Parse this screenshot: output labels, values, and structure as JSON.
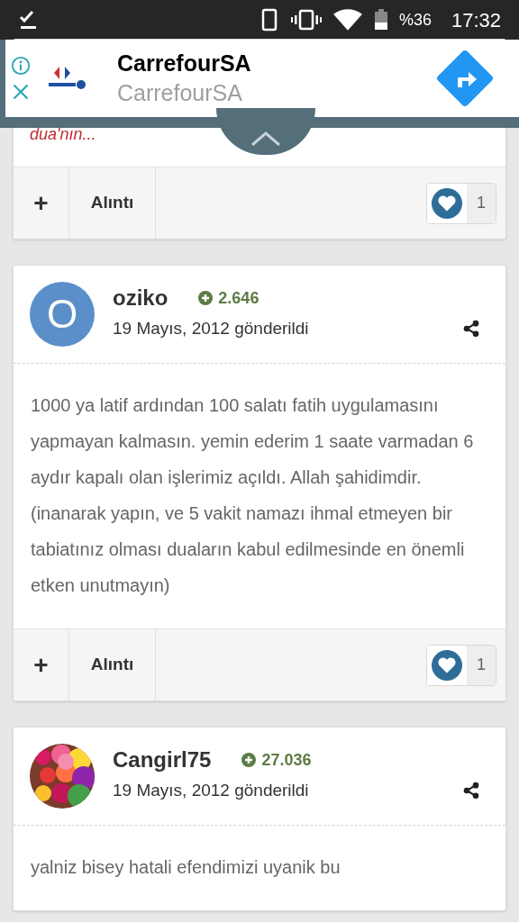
{
  "status_bar": {
    "battery": "%36",
    "time": "17:32"
  },
  "ad": {
    "title": "CarrefourSA",
    "subtitle": "CarrefourSA"
  },
  "posts": [
    {
      "excerpt": "dua'nın...",
      "plus": "+",
      "quote": "Alıntı",
      "likes": "1"
    },
    {
      "author": "oziko",
      "avatar": {
        "kind": "letter",
        "letter": "O"
      },
      "reputation": "2.646",
      "date": "19 Mayıs, 2012 gönderildi",
      "body": "1000 ya latif ardından 100 salatı fatih uygulamasını yapmayan kalmasın. yemin ederim 1 saate varmadan 6 aydır kapalı olan işlerimiz açıldı. Allah şahidimdir. (inanarak yapın, ve 5 vakit namazı ihmal etmeyen bir tabiatınız olması duaların kabul edilmesinde en önemli etken unutmayın)",
      "plus": "+",
      "quote": "Alıntı",
      "likes": "1"
    },
    {
      "author": "Cangirl75",
      "reputation": "27.036",
      "date": "19 Mayıs, 2012 gönderildi",
      "body": "yalniz bisey hatali efendimizi uyanik bu"
    }
  ]
}
